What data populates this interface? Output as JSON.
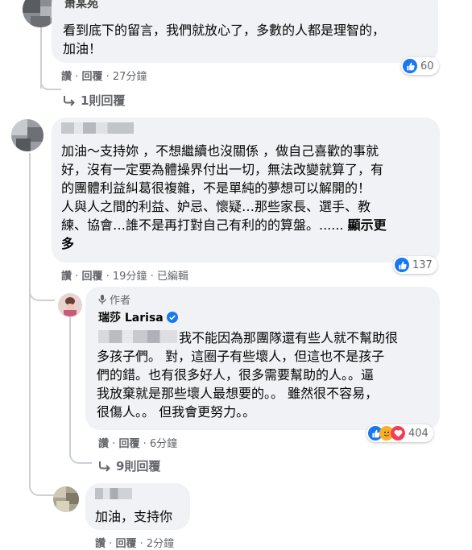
{
  "comments": [
    {
      "name": "萧某苑",
      "text_lines": [
        "看到底下的留言，我們就放心了，多數的人都是理智的，",
        "加油！"
      ],
      "actions": {
        "like": "讚",
        "reply": "回覆",
        "time": "27分鐘"
      },
      "reactions": "60",
      "replies_link": "1則回覆"
    },
    {
      "text_lines": [
        "加油～支持妳 ，不想繼續也沒關係 ，做自己喜歡的事就",
        "好，沒有一定要為體操界付出一切，無法改變就算了，有",
        "的團體利益糾葛很複雜，不是單純的夢想可以解開的！",
        "人與人之間的利益、妒忌、懷疑…那些家長、選手、教",
        "練、協會…誰不是再打對自己有利的的算盤。......"
      ],
      "show_more_1": "顯示更",
      "show_more_2": "多",
      "actions": {
        "like": "讚",
        "reply": "回覆",
        "time": "19分鐘",
        "edited": "已編輯"
      },
      "reactions": "137"
    },
    {
      "author_badge": "作者",
      "name": "瑞莎 Larisa",
      "text_lines": [
        "我不能因為那團隊還有些人就不幫助很",
        "多孩子們。 對，這圈子有些壞人，但這也不是孩子",
        "們的錯。也有很多好人，很多需要幫助的人。。逼",
        "我放棄就是那些壞人最想要的。。 雖然很不容易，",
        "很傷人。。 但我會更努力。。"
      ],
      "actions": {
        "like": "讚",
        "reply": "回覆",
        "time": "6分鐘"
      },
      "reactions": "404",
      "replies_link": "9則回覆"
    },
    {
      "text_lines": [
        "加油，支持你"
      ],
      "actions": {
        "like": "讚",
        "reply": "回覆",
        "time": "2分鐘"
      }
    }
  ],
  "separator": "·",
  "colors": {
    "bubble": "#f0f2f5",
    "meta": "#65676b",
    "like": "#1877f2",
    "verified": "#1877f2"
  }
}
